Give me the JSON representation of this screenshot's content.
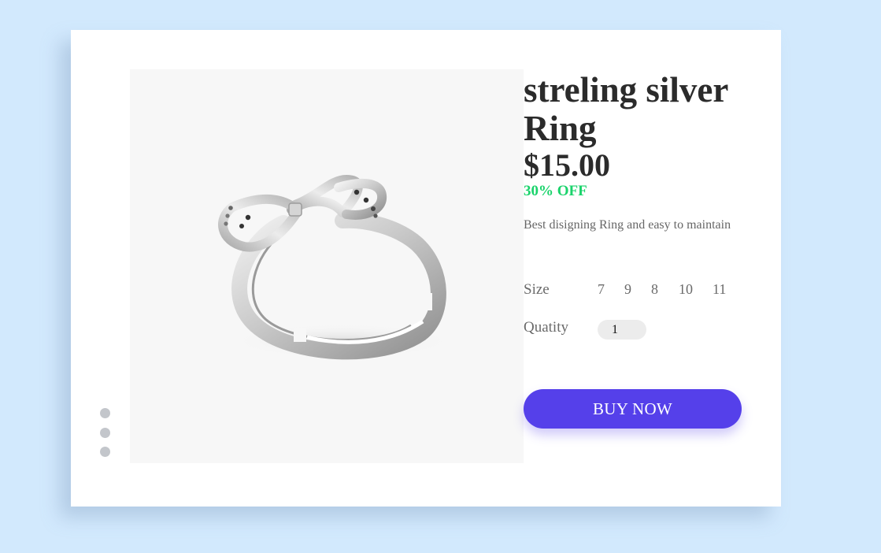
{
  "product": {
    "title": "streling silver Ring",
    "price": "$15.00",
    "discount": "30% OFF",
    "description": "Best disigning Ring and easy to maintain",
    "image_icon": "ring-image"
  },
  "size": {
    "label": "Size",
    "options": [
      "7",
      "9",
      "8",
      "10",
      "11"
    ]
  },
  "quantity": {
    "label": "Quatity",
    "value": "1"
  },
  "actions": {
    "buy_label": "BUY NOW"
  },
  "carousel": {
    "dot_count": 3
  },
  "colors": {
    "background": "#d2e9fd",
    "card": "#ffffff",
    "accent": "#5540ea",
    "discount": "#1ad36b",
    "text_dark": "#2b2b2b",
    "text_muted": "#6a6a6a",
    "dot": "#c3c6cb"
  }
}
